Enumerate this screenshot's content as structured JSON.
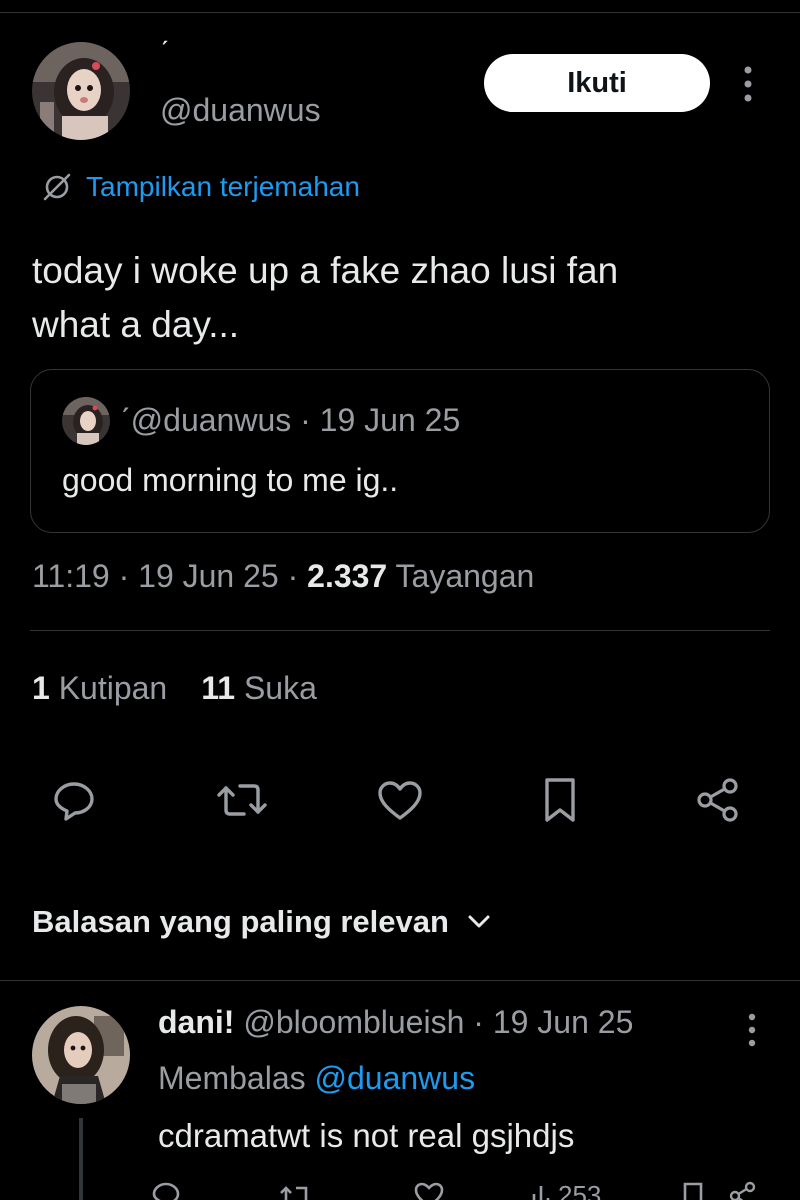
{
  "tweet": {
    "display_name": "ˊ",
    "handle": "@duanwus",
    "follow_label": "Ikuti",
    "translate_label": "Tampilkan terjemahan",
    "text_line1": "today i woke up a fake zhao lusi fan",
    "text_line2": "what a day...",
    "quote": {
      "name": "ˊ",
      "handle": "@duanwus",
      "sep": "·",
      "date": "19 Jun 25",
      "text": "good morning to me ig.."
    },
    "time": "11:19",
    "sep1": "·",
    "date": "19 Jun 25",
    "sep2": "·",
    "views_count": "2.337",
    "views_label": "Tayangan",
    "quotes_count": "1",
    "quotes_label": "Kutipan",
    "likes_count": "11",
    "likes_label": "Suka"
  },
  "actions": {
    "icons": [
      "reply-icon",
      "retweet-icon",
      "like-icon",
      "bookmark-icon",
      "share-icon"
    ]
  },
  "replies_section": {
    "sort_label": "Balasan yang paling relevan"
  },
  "reply": {
    "name": "dani!",
    "handle": "@bloomblueish",
    "sep": "·",
    "date": "19 Jun 25",
    "replying_prefix": "Membalas",
    "replying_to": "@duanwus",
    "text": "cdramatwt is not real gsjhdjs",
    "views": "253"
  },
  "colors": {
    "background": "#000000",
    "text": "#e7e9ea",
    "muted": "#9a9ea3",
    "link": "#1d9bf0",
    "border": "#2f3336",
    "follow_bg": "#ffffff"
  }
}
